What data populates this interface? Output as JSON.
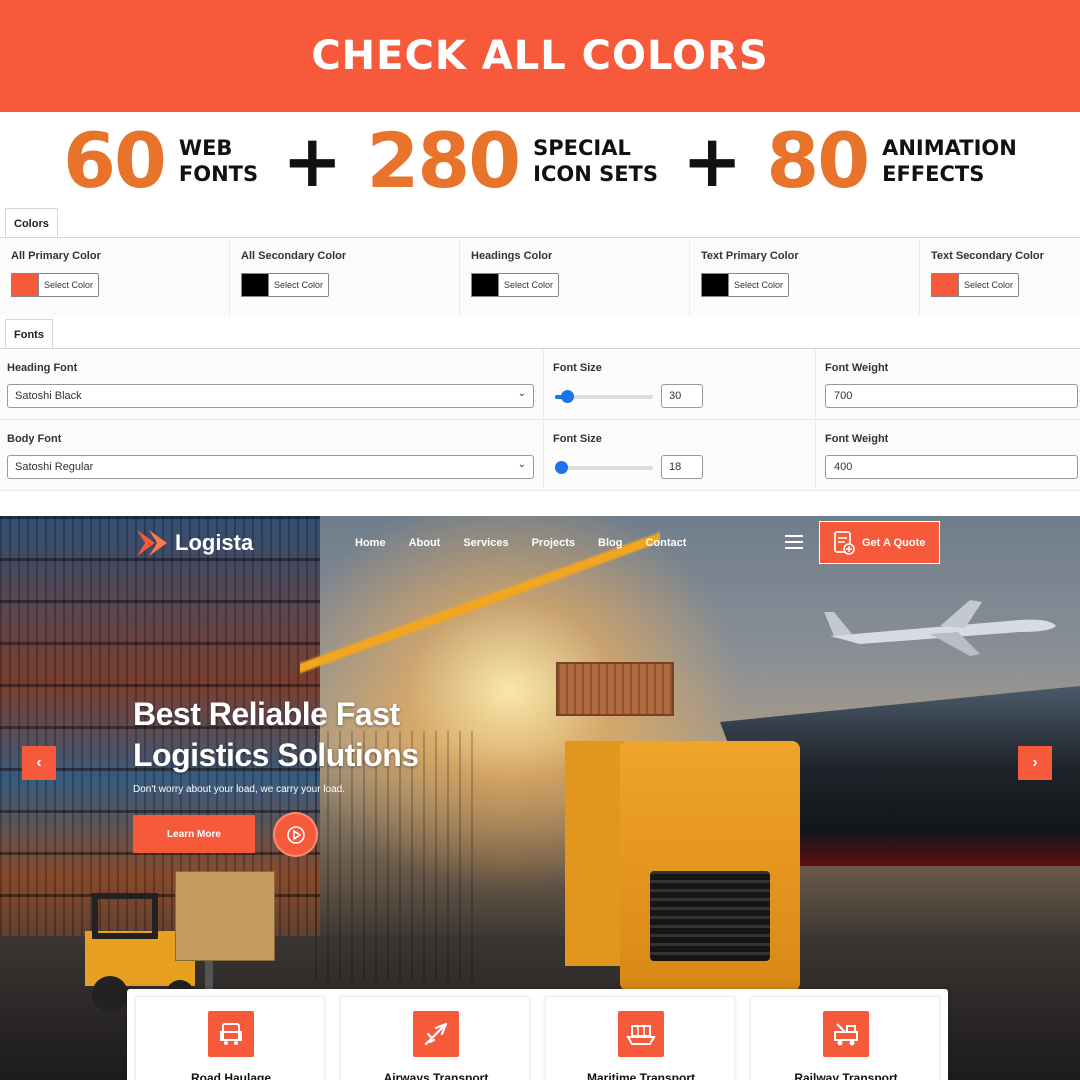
{
  "banner": {
    "title": "CHECK ALL COLORS"
  },
  "stats": [
    {
      "number": "60",
      "line1": "WEB",
      "line2": "FONTS"
    },
    {
      "number": "280",
      "line1": "SPECIAL",
      "line2": "ICON SETS"
    },
    {
      "number": "80",
      "line1": "ANIMATION",
      "line2": "EFFECTS"
    }
  ],
  "plus_sign": "+",
  "colors_panel": {
    "tab": "Colors",
    "items": [
      {
        "label": "All Primary Color",
        "swatch": "#f75a3b",
        "button": "Select Color"
      },
      {
        "label": "All Secondary Color",
        "swatch": "#000000",
        "button": "Select Color"
      },
      {
        "label": "Headings Color",
        "swatch": "#000000",
        "button": "Select Color"
      },
      {
        "label": "Text Primary Color",
        "swatch": "#000000",
        "button": "Select Color"
      },
      {
        "label": "Text Secondary Color",
        "swatch": "#f75a3b",
        "button": "Select Color"
      }
    ]
  },
  "fonts_panel": {
    "tab": "Fonts",
    "heading": {
      "font_label": "Heading Font",
      "font_value": "Satoshi Black",
      "size_label": "Font Size",
      "size_value": "30",
      "size_fraction": 0.12,
      "weight_label": "Font Weight",
      "weight_value": "700"
    },
    "body": {
      "font_label": "Body Font",
      "font_value": "Satoshi Regular",
      "size_label": "Font Size",
      "size_value": "18",
      "size_fraction": 0.06,
      "weight_label": "Font Weight",
      "weight_value": "400"
    }
  },
  "site": {
    "logo": "Logista",
    "nav": [
      "Home",
      "About",
      "Services",
      "Projects",
      "Blog",
      "Contact"
    ],
    "quote_button": "Get A Quote",
    "hero": {
      "title_line1": "Best Reliable Fast",
      "title_line2": "Logistics Solutions",
      "subtitle": "Don't worry about your load, we carry your load.",
      "cta": "Learn More"
    },
    "arrows": {
      "prev": "‹",
      "next": "›"
    },
    "services": [
      {
        "label": "Road Haulage",
        "icon": "truck-icon"
      },
      {
        "label": "Airways Transport",
        "icon": "airplane-icon"
      },
      {
        "label": "Maritime Transport",
        "icon": "ship-icon"
      },
      {
        "label": "Railway Transport",
        "icon": "tow-truck-icon"
      }
    ]
  },
  "colors": {
    "accent": "#f75a3b",
    "stat_orange": "#e8732a",
    "slider_blue": "#1a73e8"
  }
}
